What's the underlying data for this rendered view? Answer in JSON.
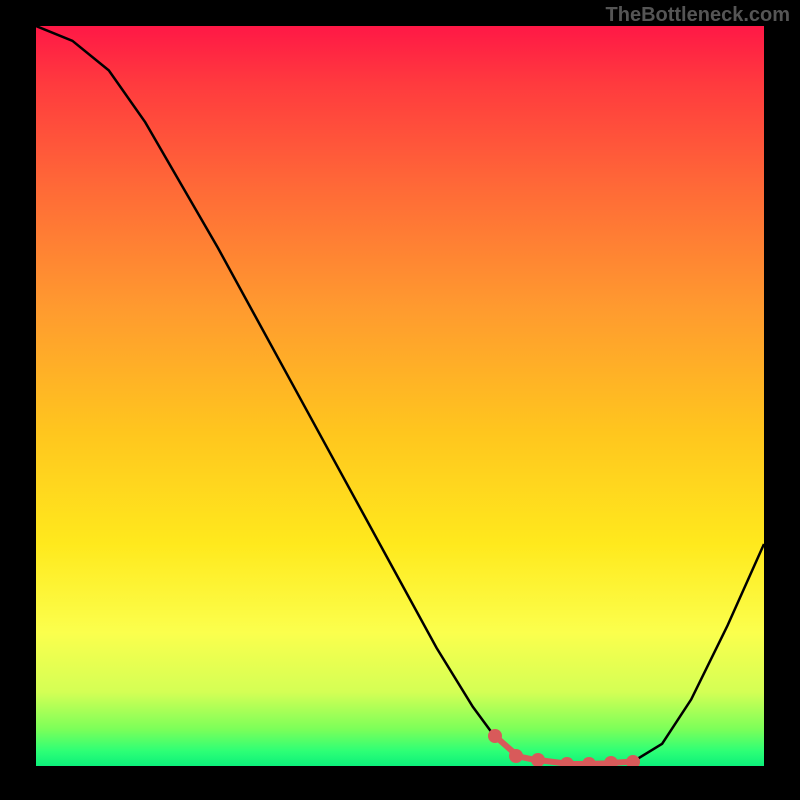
{
  "watermark": "TheBottleneck.com",
  "chart_data": {
    "type": "line",
    "title": "",
    "xlabel": "",
    "ylabel": "",
    "xlim": [
      0,
      100
    ],
    "ylim": [
      0,
      100
    ],
    "series": [
      {
        "name": "curve",
        "x": [
          0,
          5,
          10,
          15,
          20,
          25,
          30,
          35,
          40,
          45,
          50,
          55,
          60,
          63,
          66,
          70,
          74,
          78,
          82,
          86,
          90,
          95,
          100
        ],
        "y": [
          100,
          98,
          94,
          87,
          78.5,
          70,
          61,
          52,
          43,
          34,
          25,
          16,
          8,
          4,
          1.4,
          0.6,
          0.3,
          0.3,
          0.6,
          3,
          9,
          19,
          30
        ]
      }
    ],
    "highlight": {
      "x_start": 63,
      "x_end": 82,
      "points_x": [
        63,
        66,
        69,
        73,
        76,
        79,
        82
      ],
      "points_y": [
        4.0,
        1.4,
        0.8,
        0.3,
        0.3,
        0.4,
        0.6
      ],
      "color": "#d85a5a"
    },
    "colors": {
      "curve": "#000000",
      "gradient_top": "#ff1846",
      "gradient_bottom": "#0cf07a",
      "highlight": "#d85a5a"
    }
  }
}
